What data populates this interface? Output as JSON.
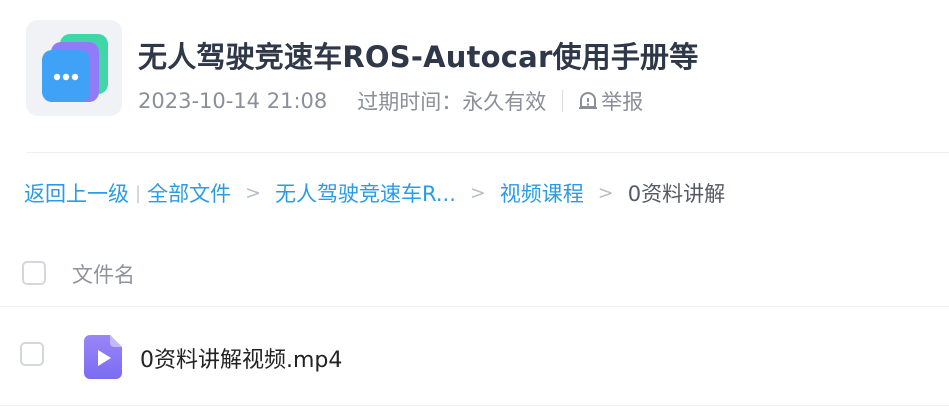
{
  "header": {
    "title": "无人驾驶竞速车ROS-Autocar使用手册等",
    "date": "2023-10-14 21:08",
    "expiry": "过期时间：永久有效",
    "report_label": "举报",
    "logo_icon": "chat-folder-icon"
  },
  "breadcrumb": {
    "back": "返回上一级",
    "bar": "|",
    "items": [
      "全部文件",
      "无人驾驶竞速车R...",
      "视频课程"
    ],
    "arrow": ">",
    "current": "0资料讲解"
  },
  "list": {
    "column_name": "文件名",
    "files": [
      {
        "name": "0资料讲解视频.mp4",
        "icon": "video-file-icon"
      }
    ]
  },
  "colors": {
    "link": "#2a9ce6",
    "title": "#2f3848",
    "meta": "#8a8f99",
    "video_icon": "#8b7cf6"
  }
}
